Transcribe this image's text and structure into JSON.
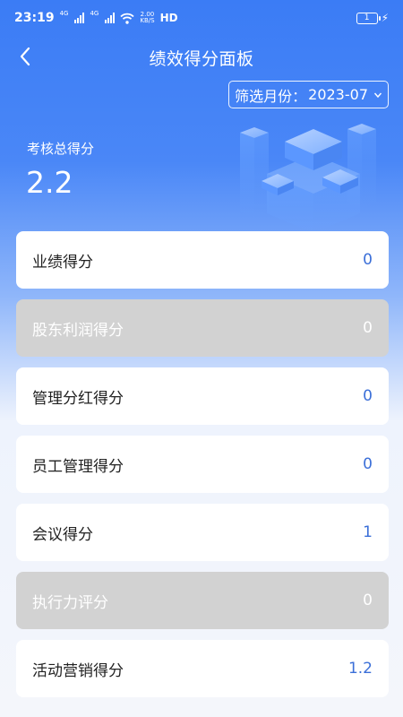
{
  "status_bar": {
    "time": "23:19",
    "signal_1": "4G",
    "signal_2": "4G",
    "speed_value": "2.00",
    "speed_unit": "KB/S",
    "hd": "HD",
    "battery": "1"
  },
  "header": {
    "title": "绩效得分面板",
    "back_icon": "chevron-left-icon"
  },
  "filter": {
    "label": "筛选月份：",
    "value": "2023-07",
    "arrow_icon": "chevron-down-icon"
  },
  "summary": {
    "label": "考核总得分",
    "value": "2.2"
  },
  "colors": {
    "accent": "#3b7cf5",
    "value_blue": "#3b6fd8",
    "disabled_card": "#d2d2d2"
  },
  "scores": [
    {
      "name": "业绩得分",
      "value": "0",
      "disabled": false
    },
    {
      "name": "股东利润得分",
      "value": "0",
      "disabled": true
    },
    {
      "name": "管理分红得分",
      "value": "0",
      "disabled": false
    },
    {
      "name": "员工管理得分",
      "value": "0",
      "disabled": false
    },
    {
      "name": "会议得分",
      "value": "1",
      "disabled": false
    },
    {
      "name": "执行力评分",
      "value": "0",
      "disabled": true
    },
    {
      "name": "活动营销得分",
      "value": "1.2",
      "disabled": false
    }
  ]
}
